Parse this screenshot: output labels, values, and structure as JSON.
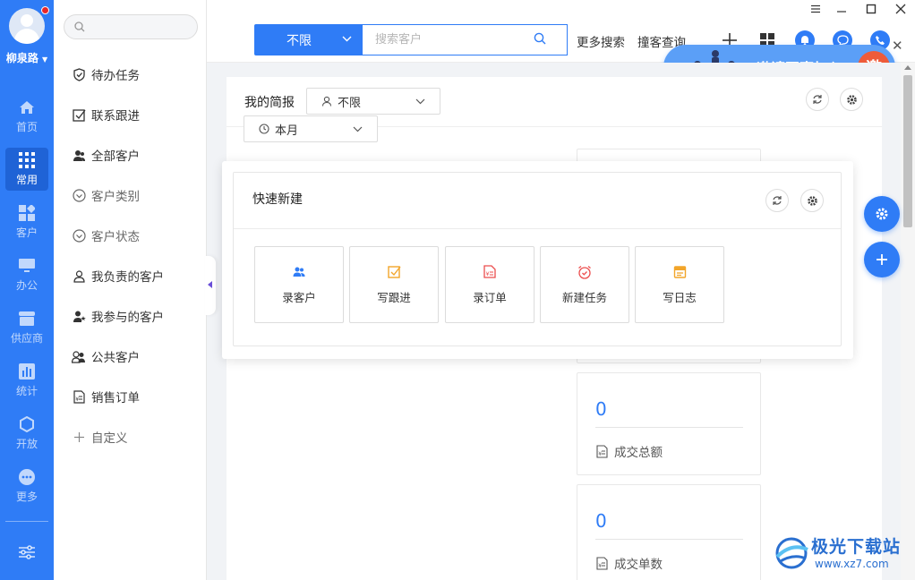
{
  "user": {
    "name": "柳泉路"
  },
  "nav": [
    {
      "label": "首页",
      "icon": "home-icon"
    },
    {
      "label": "常用",
      "icon": "grid-icon",
      "active": true
    },
    {
      "label": "客户",
      "icon": "customer-icon"
    },
    {
      "label": "办公",
      "icon": "office-icon"
    },
    {
      "label": "供应商",
      "icon": "supplier-icon"
    },
    {
      "label": "统计",
      "icon": "stats-icon"
    },
    {
      "label": "开放",
      "icon": "open-icon"
    },
    {
      "label": "更多",
      "icon": "more-icon"
    }
  ],
  "sidebar": {
    "items": [
      {
        "label": "待办任务",
        "icon": "shield-check-icon"
      },
      {
        "label": "联系跟进",
        "icon": "checkbox-icon"
      },
      {
        "label": "全部客户",
        "icon": "users-icon"
      },
      {
        "label": "客户类别",
        "icon": "circle-chevron-icon"
      },
      {
        "label": "客户状态",
        "icon": "circle-chevron-icon"
      },
      {
        "label": "我负责的客户",
        "icon": "user-group-icon"
      },
      {
        "label": "我参与的客户",
        "icon": "user-star-icon"
      },
      {
        "label": "公共客户",
        "icon": "public-users-icon"
      },
      {
        "label": "销售订单",
        "icon": "order-doc-icon"
      },
      {
        "label": "自定义",
        "icon": "plus-icon"
      }
    ]
  },
  "toolbar": {
    "scope_value": "不限",
    "search_placeholder": "搜索客户",
    "more_search": "更多搜索",
    "duplicate_check": "撞客查询"
  },
  "invite": {
    "text": "邀请同事加入",
    "badge": "邀"
  },
  "brief": {
    "title": "我的简报",
    "person_filter": "不限",
    "period_filter": "本月"
  },
  "stats": [
    {
      "value": "0",
      "label": "成交总额"
    },
    {
      "value": "0",
      "label": "成交单数"
    }
  ],
  "quick_create": {
    "title": "快速新建",
    "buttons": [
      {
        "label": "录客户",
        "icon": "add-customer-icon",
        "color": "#2f7cf6"
      },
      {
        "label": "写跟进",
        "icon": "follow-up-icon",
        "color": "#f2a52a"
      },
      {
        "label": "录订单",
        "icon": "order-icon",
        "color": "#ec4d4d"
      },
      {
        "label": "新建任务",
        "icon": "alarm-icon",
        "color": "#ec4d4d"
      },
      {
        "label": "写日志",
        "icon": "log-icon",
        "color": "#f2a52a"
      }
    ]
  },
  "watermark": {
    "title": "极光下载站",
    "url": "www.xz7.com"
  },
  "colors": {
    "primary": "#2f7cf6",
    "sidebar": "#2f7cf6",
    "danger": "#e8262a"
  }
}
